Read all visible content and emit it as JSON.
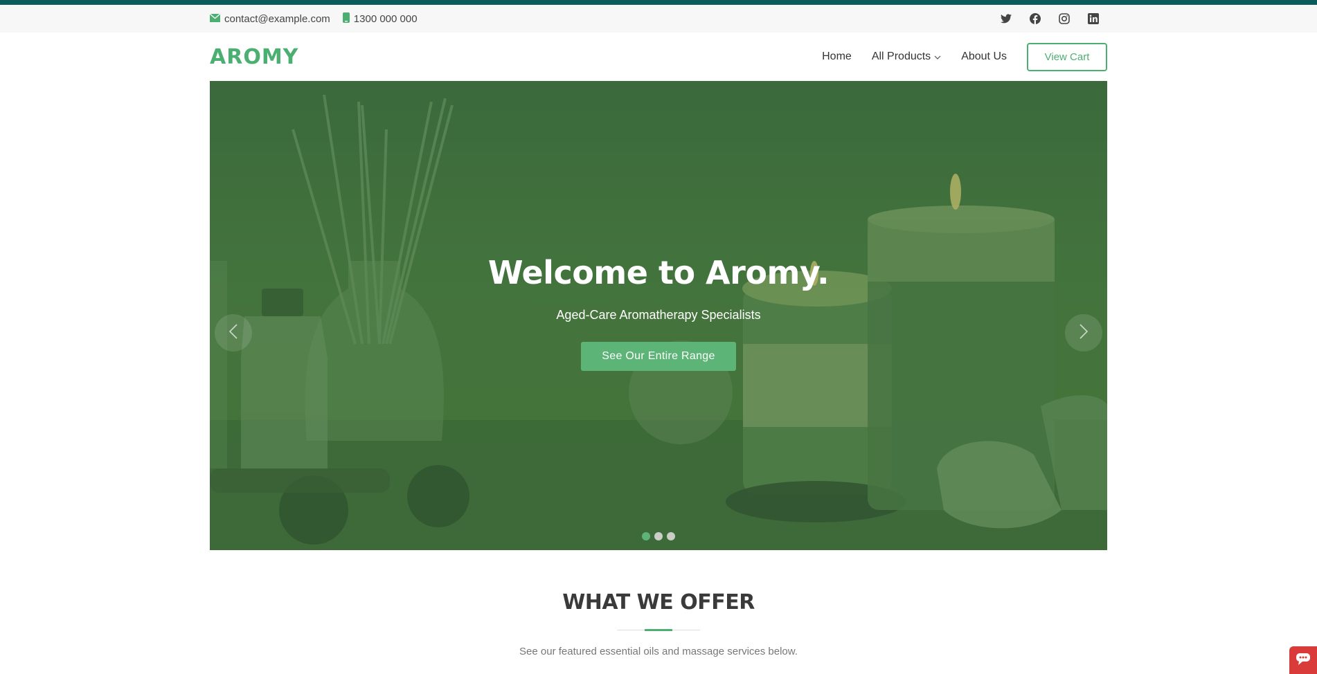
{
  "topbar": {
    "email": "contact@example.com",
    "phone": "1300 000 000",
    "socials": [
      "twitter-icon",
      "facebook-icon",
      "instagram-icon",
      "linkedin-icon"
    ]
  },
  "header": {
    "logo": "AROMY",
    "nav": {
      "home": "Home",
      "all_products": "All Products",
      "about_us": "About Us",
      "view_cart": "View Cart"
    }
  },
  "hero": {
    "title": "Welcome to Aromy.",
    "subtitle": "Aged-Care Aromatherapy Specialists",
    "button": "See Our Entire Range",
    "slides": 3,
    "active_slide": 1
  },
  "offer": {
    "title": "WHAT WE OFFER",
    "subtitle": "See our featured essential oils and massage services below."
  },
  "colors": {
    "accent": "#4caf72",
    "top_strip": "#0a5c5c",
    "chat_widget": "#d93b3b"
  }
}
